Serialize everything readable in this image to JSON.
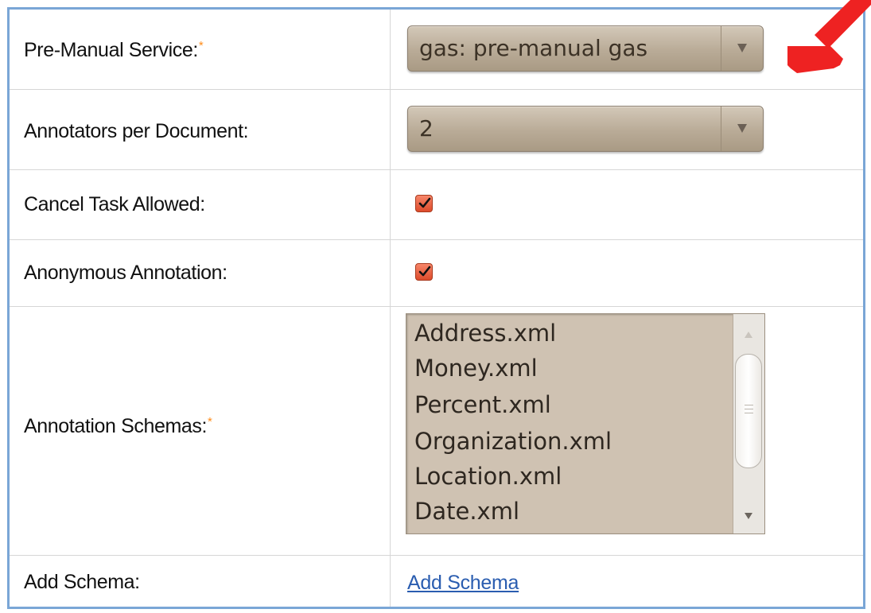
{
  "form": {
    "rows": [
      {
        "label": "Pre-Manual Service:",
        "required": "*",
        "value": "gas: pre-manual gas"
      },
      {
        "label": "Annotators per Document:",
        "value": "2"
      },
      {
        "label": "Cancel Task Allowed:",
        "checked": true
      },
      {
        "label": "Anonymous Annotation:",
        "checked": true
      },
      {
        "label": "Annotation Schemas:",
        "required": "*",
        "options": [
          "Address.xml",
          "Money.xml",
          "Percent.xml",
          "Organization.xml",
          "Location.xml",
          "Date.xml"
        ]
      },
      {
        "label": "Add Schema:",
        "link": "Add Schema"
      }
    ]
  },
  "colors": {
    "frame_border": "#7aa6d6",
    "required_marker": "#ff8c1a",
    "select_bg": "#b9ab97",
    "checkbox_fill": "#dd4b2b",
    "link": "#2a5db0",
    "pointer_arrow": "#ee2222"
  },
  "icons": [
    "chevron-down-icon",
    "checkmark-icon",
    "scroll-up-icon",
    "scroll-down-icon",
    "red-pointer-arrow-icon"
  ]
}
